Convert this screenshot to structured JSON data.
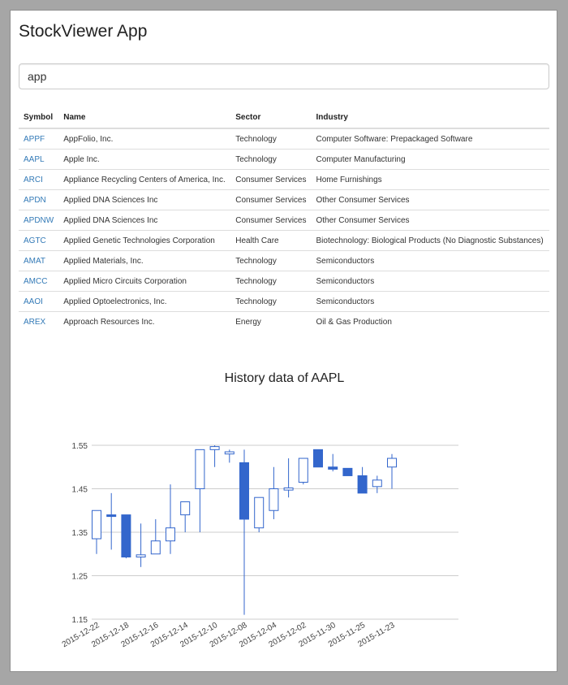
{
  "app": {
    "title": "StockViewer App"
  },
  "search": {
    "value": "app"
  },
  "table": {
    "headers": {
      "symbol": "Symbol",
      "name": "Name",
      "sector": "Sector",
      "industry": "Industry"
    },
    "rows": [
      {
        "symbol": "APPF",
        "name": "AppFolio, Inc.",
        "sector": "Technology",
        "industry": "Computer Software: Prepackaged Software"
      },
      {
        "symbol": "AAPL",
        "name": "Apple Inc.",
        "sector": "Technology",
        "industry": "Computer Manufacturing"
      },
      {
        "symbol": "ARCI",
        "name": "Appliance Recycling Centers of America, Inc.",
        "sector": "Consumer Services",
        "industry": "Home Furnishings"
      },
      {
        "symbol": "APDN",
        "name": "Applied DNA Sciences Inc",
        "sector": "Consumer Services",
        "industry": "Other Consumer Services"
      },
      {
        "symbol": "APDNW",
        "name": "Applied DNA Sciences Inc",
        "sector": "Consumer Services",
        "industry": "Other Consumer Services"
      },
      {
        "symbol": "AGTC",
        "name": "Applied Genetic Technologies Corporation",
        "sector": "Health Care",
        "industry": "Biotechnology: Biological Products (No Diagnostic Substances)"
      },
      {
        "symbol": "AMAT",
        "name": "Applied Materials, Inc.",
        "sector": "Technology",
        "industry": "Semiconductors"
      },
      {
        "symbol": "AMCC",
        "name": "Applied Micro Circuits Corporation",
        "sector": "Technology",
        "industry": "Semiconductors"
      },
      {
        "symbol": "AAOI",
        "name": "Applied Optoelectronics, Inc.",
        "sector": "Technology",
        "industry": "Semiconductors"
      },
      {
        "symbol": "AREX",
        "name": "Approach Resources Inc.",
        "sector": "Energy",
        "industry": "Oil & Gas Production"
      }
    ]
  },
  "colors": {
    "candle": "#3366cc",
    "link": "#337ab7"
  },
  "chart_data": {
    "type": "candlestick",
    "title": "History data of AAPL",
    "ylim": [
      1.15,
      1.55
    ],
    "y_ticks": [
      "1.55",
      "1.45",
      "1.35",
      "1.25",
      "1.15"
    ],
    "x_tick_labels": [
      "2015-12-22",
      "2015-12-18",
      "2015-12-16",
      "2015-12-14",
      "2015-12-10",
      "2015-12-08",
      "2015-12-04",
      "2015-12-02",
      "2015-11-30",
      "2015-11-25",
      "2015-11-23"
    ],
    "grid": true,
    "candles": [
      {
        "low": 1.3,
        "open": 1.335,
        "close": 1.4,
        "high": 1.4
      },
      {
        "low": 1.31,
        "open": 1.39,
        "close": 1.387,
        "high": 1.44
      },
      {
        "low": 1.29,
        "open": 1.39,
        "close": 1.293,
        "high": 1.39
      },
      {
        "low": 1.27,
        "open": 1.293,
        "close": 1.298,
        "high": 1.37
      },
      {
        "low": 1.3,
        "open": 1.3,
        "close": 1.33,
        "high": 1.38
      },
      {
        "low": 1.3,
        "open": 1.33,
        "close": 1.36,
        "high": 1.46
      },
      {
        "low": 1.35,
        "open": 1.39,
        "close": 1.42,
        "high": 1.42
      },
      {
        "low": 1.35,
        "open": 1.45,
        "close": 1.54,
        "high": 1.54
      },
      {
        "low": 1.5,
        "open": 1.54,
        "close": 1.547,
        "high": 1.55
      },
      {
        "low": 1.51,
        "open": 1.53,
        "close": 1.535,
        "high": 1.54
      },
      {
        "low": 1.16,
        "open": 1.51,
        "close": 1.38,
        "high": 1.54
      },
      {
        "low": 1.35,
        "open": 1.36,
        "close": 1.43,
        "high": 1.43
      },
      {
        "low": 1.38,
        "open": 1.4,
        "close": 1.45,
        "high": 1.5
      },
      {
        "low": 1.43,
        "open": 1.447,
        "close": 1.452,
        "high": 1.52
      },
      {
        "low": 1.46,
        "open": 1.465,
        "close": 1.52,
        "high": 1.52
      },
      {
        "low": 1.5,
        "open": 1.54,
        "close": 1.5,
        "high": 1.54
      },
      {
        "low": 1.49,
        "open": 1.5,
        "close": 1.495,
        "high": 1.53
      },
      {
        "low": 1.48,
        "open": 1.497,
        "close": 1.48,
        "high": 1.497
      },
      {
        "low": 1.44,
        "open": 1.48,
        "close": 1.44,
        "high": 1.5
      },
      {
        "low": 1.44,
        "open": 1.455,
        "close": 1.47,
        "high": 1.48
      },
      {
        "low": 1.45,
        "open": 1.5,
        "close": 1.52,
        "high": 1.53
      }
    ]
  }
}
